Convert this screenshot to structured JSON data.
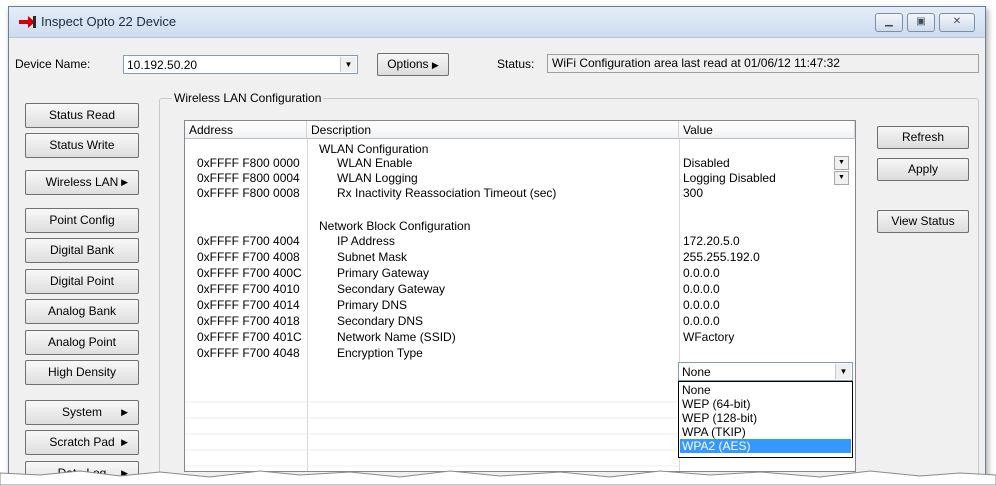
{
  "window": {
    "title": "Inspect Opto 22 Device",
    "controls": [
      "minimize",
      "maximize",
      "close"
    ]
  },
  "top_bar": {
    "device_name_label": "Device Name:",
    "device_name_value": "10.192.50.20",
    "options_label": "Options",
    "status_label": "Status:",
    "status_value": "WiFi Configuration area last read at 01/06/12 11:47:32"
  },
  "sidebar": {
    "buttons": [
      {
        "label": "Status Read",
        "submenu": false
      },
      {
        "label": "Status Write",
        "submenu": false
      },
      {
        "label": "Wireless LAN",
        "submenu": true
      },
      {
        "label": "Point Config",
        "submenu": false
      },
      {
        "label": "Digital Bank",
        "submenu": false
      },
      {
        "label": "Digital Point",
        "submenu": false
      },
      {
        "label": "Analog Bank",
        "submenu": false
      },
      {
        "label": "Analog Point",
        "submenu": false
      },
      {
        "label": "High Density",
        "submenu": false
      },
      {
        "label": "System",
        "submenu": true
      },
      {
        "label": "Scratch Pad",
        "submenu": true
      },
      {
        "label": "Data Log",
        "submenu": true
      }
    ]
  },
  "group": {
    "label": "Wireless LAN Configuration"
  },
  "grid": {
    "columns": [
      "Address",
      "Description",
      "Value"
    ],
    "rows": [
      {
        "address": "",
        "description": "WLAN Configuration",
        "value": "",
        "section": true
      },
      {
        "address": "0xFFFF F800 0000",
        "description": "WLAN Enable",
        "value": "Disabled",
        "dropdown": true
      },
      {
        "address": "0xFFFF F800 0004",
        "description": "WLAN Logging",
        "value": "Logging Disabled",
        "dropdown": true
      },
      {
        "address": "0xFFFF F800 0008",
        "description": "Rx Inactivity Reassociation Timeout (sec)",
        "value": "300"
      },
      {
        "address": "",
        "description": "",
        "value": ""
      },
      {
        "address": "",
        "description": "Network Block Configuration",
        "value": "",
        "section": true
      },
      {
        "address": "0xFFFF F700 4004",
        "description": "IP Address",
        "value": "172.20.5.0"
      },
      {
        "address": "0xFFFF F700 4008",
        "description": "Subnet Mask",
        "value": "255.255.192.0"
      },
      {
        "address": "0xFFFF F700 400C",
        "description": "Primary Gateway",
        "value": "0.0.0.0"
      },
      {
        "address": "0xFFFF F700 4010",
        "description": "Secondary Gateway",
        "value": "0.0.0.0"
      },
      {
        "address": "0xFFFF F700 4014",
        "description": "Primary DNS",
        "value": "0.0.0.0"
      },
      {
        "address": "0xFFFF F700 4018",
        "description": "Secondary DNS",
        "value": "0.0.0.0"
      },
      {
        "address": "0xFFFF F700 401C",
        "description": "Network Name (SSID)",
        "value": "WFactory"
      },
      {
        "address": "0xFFFF F700 4048",
        "description": "Encryption Type",
        "value": ""
      }
    ],
    "encryption": {
      "selected": "None",
      "options": [
        "None",
        "WEP (64-bit)",
        "WEP (128-bit)",
        "WPA (TKIP)",
        "WPA2 (AES)"
      ],
      "highlighted": "WPA2 (AES)"
    }
  },
  "actions": {
    "refresh": "Refresh",
    "apply": "Apply",
    "view_status": "View Status"
  },
  "colors": {
    "selection": "#3399ff",
    "window_bg": "#f0f0f0",
    "title_bar": "#d6e3f2"
  }
}
